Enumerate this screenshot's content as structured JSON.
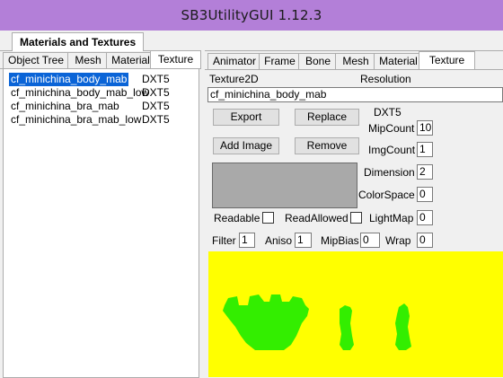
{
  "window": {
    "title": "SB3UtilityGUI 1.12.3"
  },
  "main_tab": {
    "label": "Materials and Textures"
  },
  "left_tabs": [
    "Object Tree",
    "Mesh",
    "Material",
    "Texture"
  ],
  "texture_list": [
    {
      "name": "cf_minichina_body_mab",
      "format": "DXT5",
      "selected": true
    },
    {
      "name": "cf_minichina_body_mab_low",
      "format": "DXT5",
      "selected": false
    },
    {
      "name": "cf_minichina_bra_mab",
      "format": "DXT5",
      "selected": false
    },
    {
      "name": "cf_minichina_bra_mab_low",
      "format": "DXT5",
      "selected": false
    }
  ],
  "right_tabs": [
    "Animator",
    "Frame",
    "Bone",
    "Mesh",
    "Material",
    "Texture"
  ],
  "editor": {
    "type_label": "Texture2D",
    "resolution_label": "Resolution",
    "name_value": "cf_minichina_body_mab",
    "format_value": "DXT5",
    "export_label": "Export",
    "replace_label": "Replace",
    "add_image_label": "Add Image",
    "remove_label": "Remove",
    "mipcount_label": "MipCount",
    "mipcount_value": "10",
    "imgcount_label": "ImgCount",
    "imgcount_value": "1",
    "dimension_label": "Dimension",
    "dimension_value": "2",
    "colorspace_label": "ColorSpace",
    "colorspace_value": "0",
    "readable_label": "Readable",
    "readallowed_label": "ReadAllowed",
    "lightmap_label": "LightMap",
    "lightmap_value": "0",
    "filter_label": "Filter",
    "filter_value": "1",
    "aniso_label": "Aniso",
    "aniso_value": "1",
    "mipbias_label": "MipBias",
    "mipbias_value": "0",
    "wrap_label": "Wrap",
    "wrap_value": "0"
  },
  "colors": {
    "titlebar": "#b37fd8",
    "selection": "#0a64d7",
    "preview_background": "#ffff00",
    "preview_shapes": "#33ee00",
    "swatch": "#a9a9a9"
  }
}
